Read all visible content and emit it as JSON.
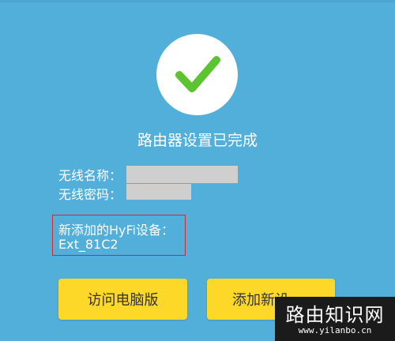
{
  "status": {
    "icon": "checkmark-icon",
    "icon_color": "#5cc431",
    "title": "路由器设置已完成"
  },
  "wireless": {
    "name_label": "无线名称：",
    "password_label": "无线密码："
  },
  "new_device": {
    "label": "新添加的HyFi设备：",
    "name": "Ext_81C2",
    "highlight_color": "#d6272a"
  },
  "buttons": {
    "visit_pc": "访问电脑版",
    "add_device": "添加新设"
  },
  "watermark": {
    "title": "路由知识网",
    "url": "www.yilanbo.cn"
  },
  "colors": {
    "background": "#52afd9",
    "button": "#fdd829"
  }
}
